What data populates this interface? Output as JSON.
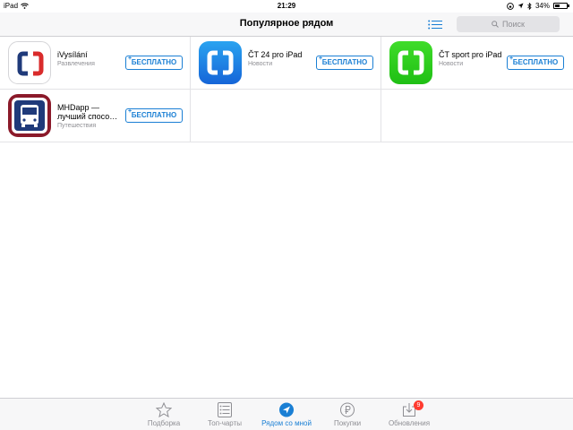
{
  "status_bar": {
    "device": "iPad",
    "time": "21:29",
    "battery": "34%",
    "battery_level": 0.34
  },
  "nav": {
    "title": "Популярное рядом",
    "search_placeholder": "Поиск"
  },
  "apps": [
    {
      "name": "iVysílání",
      "category": "Развлечения",
      "button": "БЕСПЛАТНО",
      "plus": "+"
    },
    {
      "name": "ČT 24 pro iPad",
      "category": "Новости",
      "button": "БЕСПЛАТНО",
      "plus": "+"
    },
    {
      "name": "ČT sport pro iPad",
      "category": "Новости",
      "button": "БЕСПЛАТНО",
      "plus": "+"
    },
    {
      "name": "MHDapp — лучший спосо…",
      "category": "Путешествия",
      "button": "БЕСПЛАТНО",
      "plus": "+"
    }
  ],
  "tabs": [
    {
      "label": "Подборка",
      "icon": "star-icon"
    },
    {
      "label": "Топ-чарты",
      "icon": "list-icon"
    },
    {
      "label": "Рядом со мной",
      "icon": "location-icon",
      "active": true
    },
    {
      "label": "Покупки",
      "icon": "purchased-icon"
    },
    {
      "label": "Обновления",
      "icon": "updates-icon",
      "badge": "9"
    }
  ],
  "colors": {
    "accent": "#1a7fd4",
    "badge": "#ff3b30",
    "ct_blue": "#1e88e5",
    "ct_green": "#2ecc1a",
    "ct_red": "#d92b2b"
  }
}
